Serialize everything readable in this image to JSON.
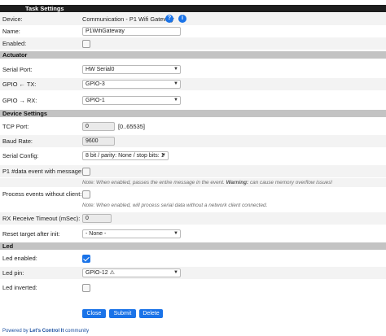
{
  "header": {
    "title": "Task Settings"
  },
  "device": {
    "label": "Device:",
    "value": "Communication - P1 Wifi Gateway",
    "help_icon": "question-icon",
    "info_icon": "info-icon",
    "help_glyph": "?",
    "info_glyph": "i"
  },
  "name": {
    "label": "Name:",
    "value": "P1WifiGateway"
  },
  "enabled": {
    "label": "Enabled:",
    "checked": false
  },
  "actuator": {
    "title": "Actuator",
    "serial_port": {
      "label": "Serial Port:",
      "value": "HW Serial0"
    },
    "gpio_tx": {
      "label": "GPIO ← TX:",
      "value": "GPIO-3"
    },
    "gpio_rx": {
      "label": "GPIO → RX:",
      "value": "GPIO-1"
    }
  },
  "device_settings": {
    "title": "Device Settings",
    "tcp_port": {
      "label": "TCP Port:",
      "value": "0",
      "range": "[0..65535]"
    },
    "baud_rate": {
      "label": "Baud Rate:",
      "value": "9600"
    },
    "serial_config": {
      "label": "Serial Config:",
      "value": "8 bit / parity: None / stop bits: 1"
    },
    "p1_data": {
      "label": "P1 #data event with message:",
      "checked": false,
      "note_prefix": "Note: When enabled, passes the entire message in the event.",
      "note_warning": "Warning:",
      "note_suffix": "can cause memory overflow issues!"
    },
    "process_events": {
      "label": "Process events without client:",
      "checked": false,
      "note": "Note: When enabled, will process serial data without a network client connected."
    },
    "rx_timeout": {
      "label": "RX Receive Timeout (mSec):",
      "value": "0"
    },
    "reset_target": {
      "label": "Reset target after init:",
      "value": "- None -"
    }
  },
  "led": {
    "title": "Led",
    "enabled": {
      "label": "Led enabled:",
      "checked": true
    },
    "pin": {
      "label": "Led pin:",
      "value": "GPIO-12 ⚠"
    },
    "inverted": {
      "label": "Led inverted:",
      "checked": false
    }
  },
  "buttons": {
    "close": "Close",
    "submit": "Submit",
    "delete": "Delete"
  },
  "footer": {
    "prefix": "Powered by",
    "brand": "Let's Control It",
    "suffix": "community"
  },
  "colors": {
    "accent": "#1a73e8",
    "header_bg": "#1e1e1e",
    "section_bg": "#c3c3c3"
  }
}
